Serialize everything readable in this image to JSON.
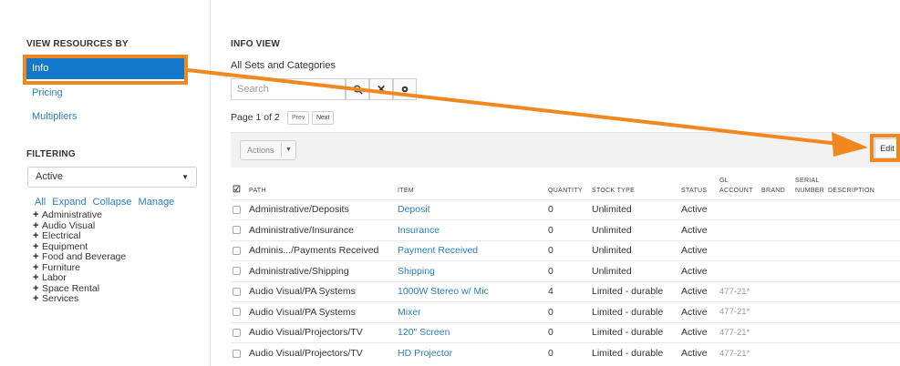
{
  "sidebar": {
    "view_heading": "VIEW RESOURCES BY",
    "nav": [
      {
        "label": "Info",
        "active": true
      },
      {
        "label": "Pricing",
        "active": false
      },
      {
        "label": "Multipliers",
        "active": false
      }
    ],
    "filter_heading": "FILTERING",
    "filter_select": "Active",
    "tree_links": [
      "All",
      "Expand",
      "Collapse",
      "Manage"
    ],
    "tree": [
      "Administrative",
      "Audio Visual",
      "Electrical",
      "Equipment",
      "Food and Beverage",
      "Furniture",
      "Labor",
      "Space Rental",
      "Services"
    ]
  },
  "main": {
    "heading": "INFO VIEW",
    "subheading": "All Sets and Categories",
    "search_placeholder": "Search",
    "page_info": "Page 1 of 2",
    "prev_label": "Prev",
    "next_label": "Next",
    "actions_label": "Actions",
    "edit_label": "Edit",
    "columns": [
      "PATH",
      "ITEM",
      "QUANTITY",
      "STOCK TYPE",
      "STATUS",
      "GL ACCOUNT",
      "BRAND",
      "SERIAL NUMBER",
      "DESCRIPTION"
    ],
    "rows": [
      {
        "path": "Administrative/Deposits",
        "item": "Deposit",
        "quantity": "0",
        "stock_type": "Unlimited",
        "status": "Active",
        "gl": ""
      },
      {
        "path": "Administrative/Insurance",
        "item": "Insurance",
        "quantity": "0",
        "stock_type": "Unlimited",
        "status": "Active",
        "gl": ""
      },
      {
        "path": "Adminis.../Payments Received",
        "item": "Payment Received",
        "quantity": "0",
        "stock_type": "Unlimited",
        "status": "Active",
        "gl": ""
      },
      {
        "path": "Administrative/Shipping",
        "item": "Shipping",
        "quantity": "0",
        "stock_type": "Unlimited",
        "status": "Active",
        "gl": ""
      },
      {
        "path": "Audio Visual/PA Systems",
        "item": "1000W Stereo w/ Mic",
        "quantity": "4",
        "stock_type": "Limited - durable",
        "status": "Active",
        "gl": "477-21*"
      },
      {
        "path": "Audio Visual/PA Systems",
        "item": "Mixer",
        "quantity": "0",
        "stock_type": "Limited - durable",
        "status": "Active",
        "gl": "477-21*"
      },
      {
        "path": "Audio Visual/Projectors/TV",
        "item": "120\" Screen",
        "quantity": "0",
        "stock_type": "Limited - durable",
        "status": "Active",
        "gl": "477-21*"
      },
      {
        "path": "Audio Visual/Projectors/TV",
        "item": "HD Projector",
        "quantity": "0",
        "stock_type": "Limited - durable",
        "status": "Active",
        "gl": "477-21*"
      }
    ]
  },
  "colors": {
    "accent": "#1478c8",
    "link": "#2a7fc0",
    "highlight": "#f0871f"
  }
}
